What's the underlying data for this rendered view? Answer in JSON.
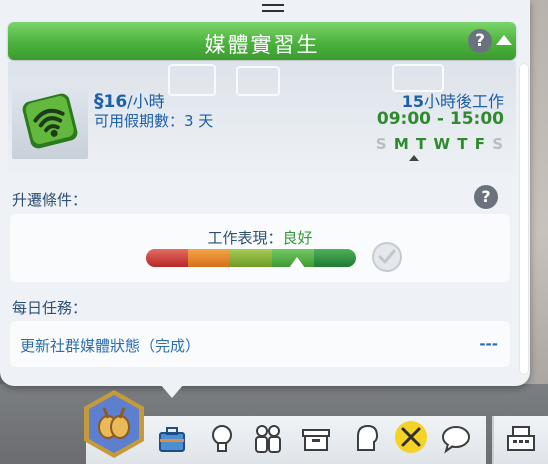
{
  "career_panel": {
    "title": "媒體實習生",
    "help_label": "?",
    "salary": {
      "currency_symbol": "§",
      "amount": "16",
      "unit": "/小時"
    },
    "days_off": "可用假期數：3 天",
    "work_in": {
      "hours": "15",
      "suffix": "小時後工作"
    },
    "work_hours": "09:00 - 15:00",
    "work_days": [
      {
        "letter": "S",
        "active": false
      },
      {
        "letter": "M",
        "active": true
      },
      {
        "letter": "T",
        "active": true
      },
      {
        "letter": "W",
        "active": true
      },
      {
        "letter": "T",
        "active": true
      },
      {
        "letter": "F",
        "active": true
      },
      {
        "letter": "S",
        "active": false
      }
    ],
    "promotion_label": "升遷條件：",
    "performance": {
      "label": "工作表現：",
      "value": "良好",
      "level_fraction": 0.72
    },
    "daily_tasks_label": "每日任務：",
    "tasks": [
      {
        "text": "更新社群媒體狀態（完成）",
        "status": "---"
      }
    ]
  },
  "colors": {
    "title_green": "#4cb23d",
    "text_blue": "#1d5fa8",
    "good_green": "#2f9a3a"
  },
  "toolbar": {
    "icons": [
      "aspiration-hex-icon",
      "career-briefcase-icon",
      "skills-lightbulb-icon",
      "relationships-icon",
      "inventory-box-icon",
      "moodlet-head-icon",
      "career-tools-icon",
      "social-speech-icon",
      "cash-register-icon"
    ]
  }
}
